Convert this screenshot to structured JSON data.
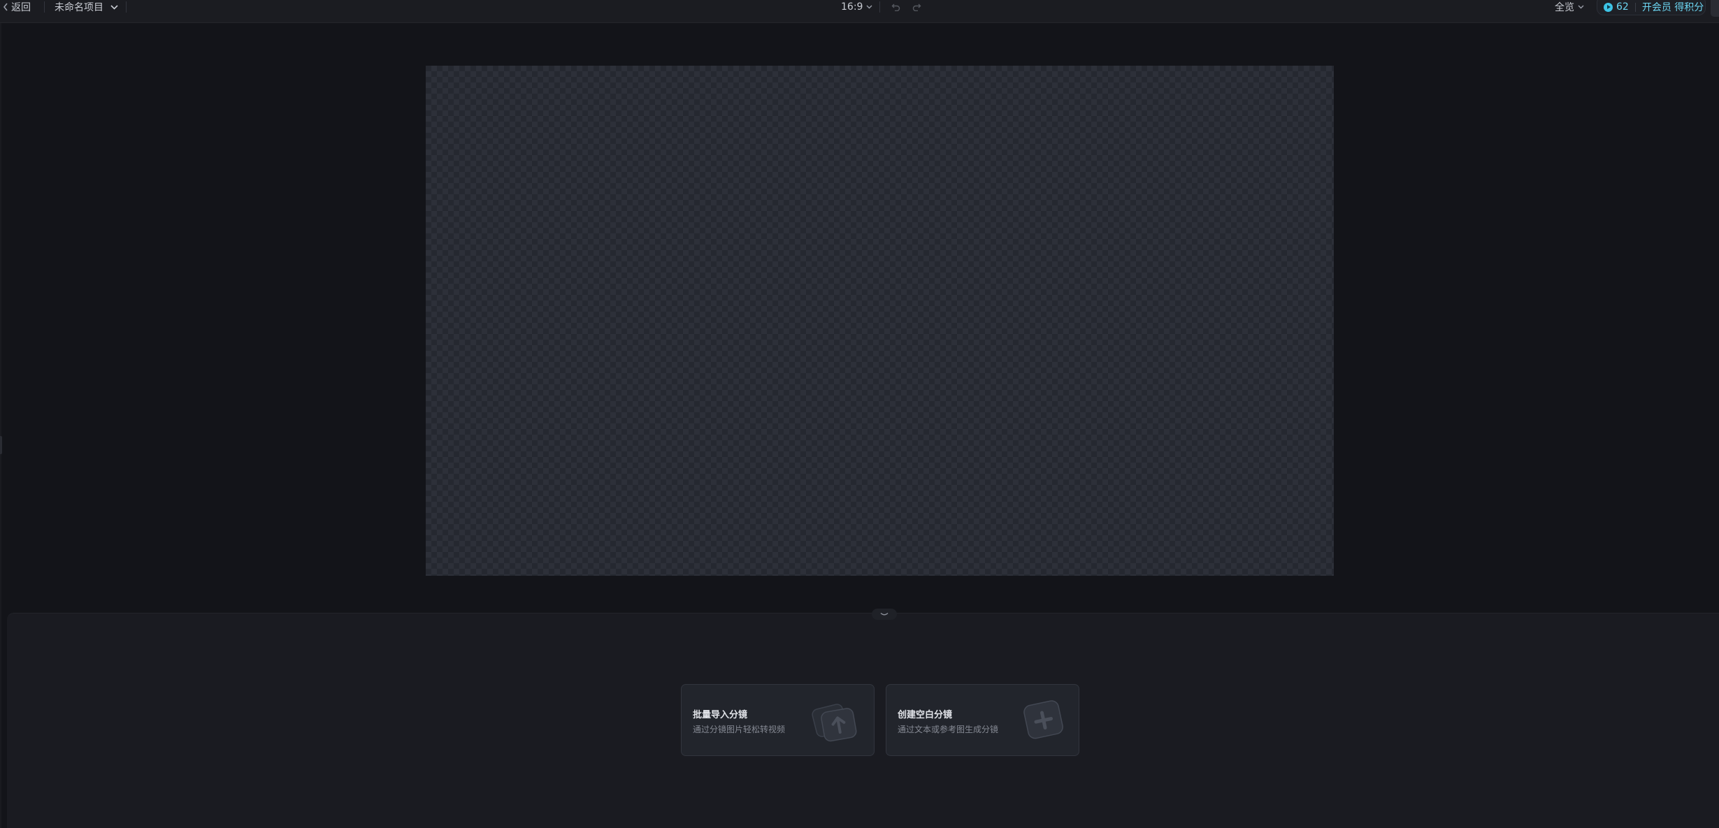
{
  "topbar": {
    "back_label": "返回",
    "project_name": "未命名项目",
    "aspect_ratio": "16:9",
    "zoom_label": "全览",
    "credits": {
      "count": "62",
      "member_label": "开会员 得积分",
      "accent_color": "#3dc4e6"
    }
  },
  "icons": {
    "back": "chevron-left-icon",
    "project_menu": "chevron-down-icon",
    "ratio_menu": "chevron-down-icon",
    "undo": "undo-icon",
    "redo": "redo-icon",
    "zoom_menu": "chevron-down-icon",
    "credit": "coin-icon",
    "collapse": "chevron-down-icon",
    "batch_import": "image-stack-upload-icon",
    "blank_storyboard": "image-plus-icon"
  },
  "storyboard": {
    "cards": [
      {
        "title": "批量导入分镜",
        "description": "通过分镜图片轻松转视频"
      },
      {
        "title": "创建空白分镜",
        "description": "通过文本或参考图生成分镜"
      }
    ]
  }
}
